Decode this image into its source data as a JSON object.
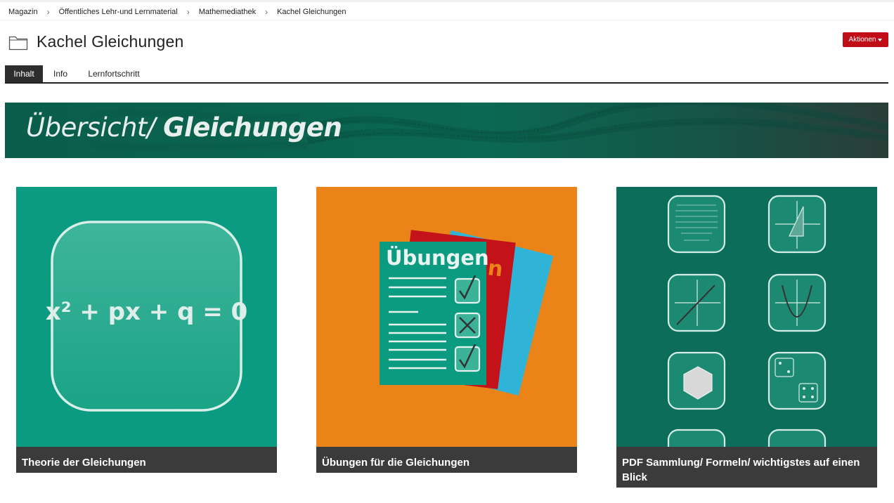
{
  "breadcrumb": [
    "Magazin",
    "Öffentliches Lehr-und Lernmaterial",
    "Mathemediathek",
    "Kachel Gleichungen"
  ],
  "page": {
    "title": "Kachel Gleichungen",
    "actions_label": "Aktionen"
  },
  "tabs": [
    {
      "label": "Inhalt",
      "active": true
    },
    {
      "label": "Info",
      "active": false
    },
    {
      "label": "Lernfortschritt",
      "active": false
    }
  ],
  "banner": {
    "title_light": "Übersicht/",
    "title_bold": "Gleichungen"
  },
  "tiles": [
    {
      "caption": "Theorie der Gleichungen",
      "formula": "x² + px + q = 0"
    },
    {
      "caption": "Übungen für die Gleichungen",
      "sheet_title": "Übungen"
    },
    {
      "caption": "PDF Sammlung/ Formeln/ wichtigstes auf einen Blick"
    }
  ]
}
